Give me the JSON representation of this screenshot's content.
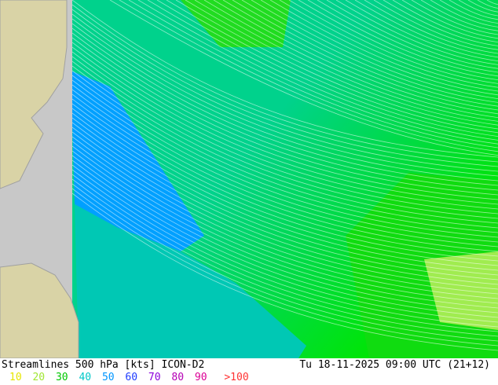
{
  "title": "Streamlines 500 hPa [kts] ICON-D2",
  "datetime": "Tu 18-11-2025 09:00 UTC (21+12)",
  "legend": [
    {
      "label": "10",
      "color": "#e6e600"
    },
    {
      "label": "20",
      "color": "#a0e632"
    },
    {
      "label": "30",
      "color": "#00c800"
    },
    {
      "label": "40",
      "color": "#00c8c8"
    },
    {
      "label": "50",
      "color": "#0096ff"
    },
    {
      "label": "60",
      "color": "#1e3cff"
    },
    {
      "label": "70",
      "color": "#8c00dc"
    },
    {
      "label": "80",
      "color": "#b400b4"
    },
    {
      "label": "90",
      "color": "#dc0096"
    },
    {
      "label": ">100",
      "color": "#ff3232"
    }
  ],
  "colors": {
    "land": "#d9d3a6",
    "outside": "#c8c8c8",
    "coast": "#a0a0a0"
  }
}
